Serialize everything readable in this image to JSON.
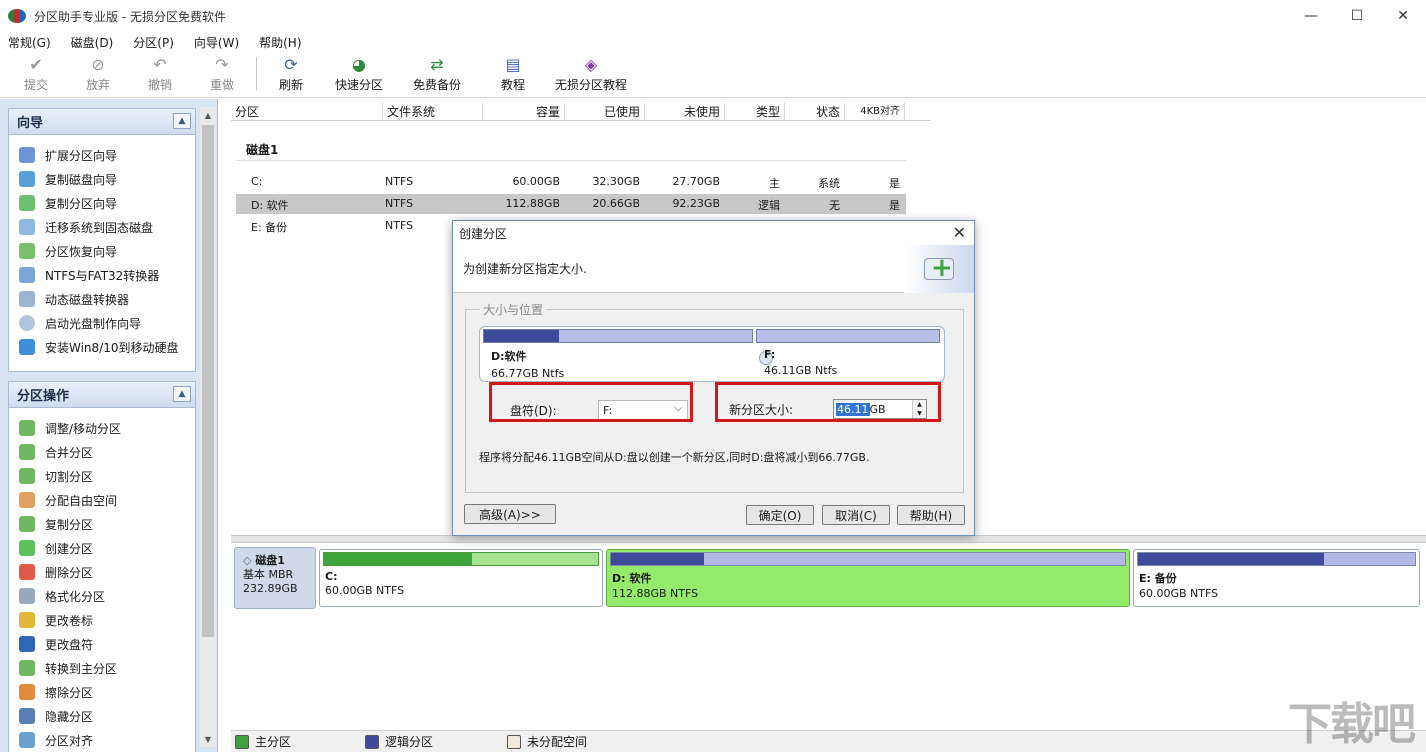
{
  "window": {
    "title": "分区助手专业版 - 无损分区免费软件",
    "minimize": "—",
    "maximize": "☐",
    "close": "✕"
  },
  "menu": [
    "常规(G)",
    "磁盘(D)",
    "分区(P)",
    "向导(W)",
    "帮助(H)"
  ],
  "toolbar": {
    "submit": "提交",
    "discard": "放弃",
    "undo": "撤销",
    "redo": "重做",
    "refresh": "刷新",
    "quick_partition": "快速分区",
    "free_backup": "免费备份",
    "tutorial": "教程",
    "lossless_tutorial": "无损分区教程"
  },
  "wizard": {
    "title": "向导",
    "items": [
      "扩展分区向导",
      "复制磁盘向导",
      "复制分区向导",
      "迁移系统到固态磁盘",
      "分区恢复向导",
      "NTFS与FAT32转换器",
      "动态磁盘转换器",
      "启动光盘制作向导",
      "安装Win8/10到移动硬盘"
    ]
  },
  "ops": {
    "title": "分区操作",
    "items": [
      "调整/移动分区",
      "合并分区",
      "切割分区",
      "分配自由空间",
      "复制分区",
      "创建分区",
      "删除分区",
      "格式化分区",
      "更改卷标",
      "更改盘符",
      "转换到主分区",
      "擦除分区",
      "隐藏分区",
      "分区对齐"
    ]
  },
  "table": {
    "headers": [
      "分区",
      "文件系统",
      "容量",
      "已使用",
      "未使用",
      "类型",
      "状态",
      "4KB对齐"
    ],
    "disk": "磁盘1",
    "rows": [
      [
        "C:",
        "NTFS",
        "60.00GB",
        "32.30GB",
        "27.70GB",
        "主",
        "系统",
        "是"
      ],
      [
        "D: 软件",
        "NTFS",
        "112.88GB",
        "20.66GB",
        "92.23GB",
        "逻辑",
        "无",
        "是"
      ],
      [
        "E: 备份",
        "NTFS",
        "",
        "",
        "",
        "",
        "",
        ""
      ]
    ]
  },
  "diskmap": {
    "disk_name": "磁盘1",
    "disk_type": "基本 MBR",
    "disk_size": "232.89GB",
    "parts": [
      {
        "name": "C:",
        "info": "60.00GB NTFS",
        "used_fraction": 0.54
      },
      {
        "name": "D: 软件",
        "info": "112.88GB NTFS",
        "used_fraction": 0.18
      },
      {
        "name": "E: 备份",
        "info": "60.00GB NTFS",
        "used_fraction": 0.67
      }
    ]
  },
  "legend": [
    "主分区",
    "逻辑分区",
    "未分配空间"
  ],
  "dialog": {
    "title": "创建分区",
    "header": "为创建新分区指定大小.",
    "group_label": "大小与位置",
    "left_part": {
      "name": "D:软件",
      "info": "66.77GB Ntfs",
      "used_fraction": 0.28
    },
    "right_part": {
      "name": "F:",
      "info": "46.11GB Ntfs"
    },
    "drive_label": "盘符(D):",
    "drive_value": "F:",
    "size_label": "新分区大小:",
    "size_value": "46.11",
    "size_unit": "GB",
    "description": "程序将分配46.11GB空间从D:盘以创建一个新分区,同时D:盘将减小到66.77GB.",
    "advanced": "高级(A)>>",
    "ok": "确定(O)",
    "cancel": "取消(C)",
    "help": "帮助(H)"
  },
  "watermark": "下载吧",
  "colors": {
    "primary": "#3da43d",
    "logical": "#3f4a9a",
    "selected_part": "#94ea6a"
  }
}
